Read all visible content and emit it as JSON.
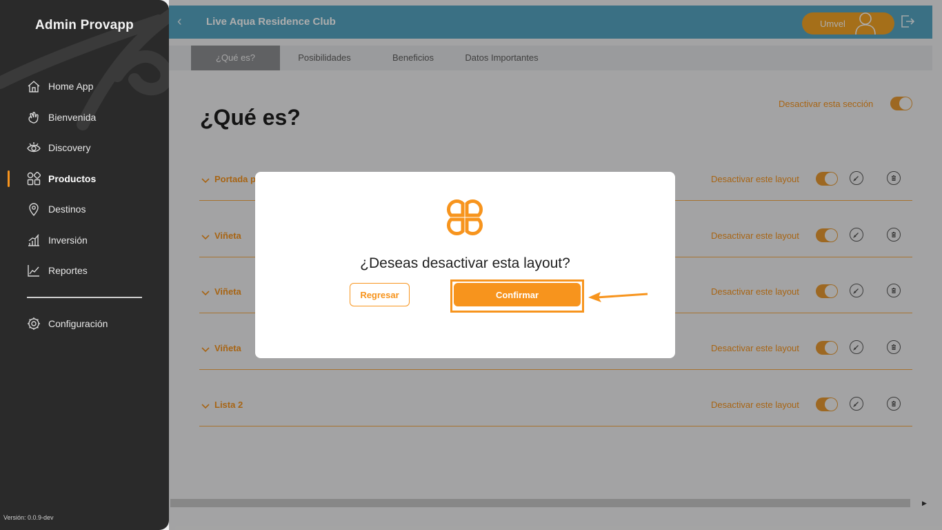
{
  "app": {
    "brand": "Admin Provapp",
    "version": "Versión: 0.0.9-dev"
  },
  "sidebar": {
    "items": [
      {
        "label": "Home App",
        "icon": "home-icon"
      },
      {
        "label": "Bienvenida",
        "icon": "waving-hand-icon"
      },
      {
        "label": "Discovery",
        "icon": "eye-icon"
      },
      {
        "label": "Productos",
        "icon": "grid-shapes-icon",
        "active": true
      },
      {
        "label": "Destinos",
        "icon": "map-pin-icon"
      },
      {
        "label": "Inversión",
        "icon": "bar-growth-icon"
      },
      {
        "label": "Reportes",
        "icon": "line-chart-icon"
      }
    ],
    "settings": {
      "label": "Configuración",
      "icon": "gear-icon"
    }
  },
  "header": {
    "title": "Live Aqua Residence Club",
    "user": "Umvel"
  },
  "tabs": [
    {
      "label": "¿Qué es?",
      "active": true
    },
    {
      "label": "Posibilidades"
    },
    {
      "label": "Beneficios"
    },
    {
      "label": "Datos Importantes"
    }
  ],
  "main": {
    "title": "¿Qué es?",
    "section_toggle_label": "Desactivar esta sección",
    "rows": [
      {
        "label": "Portada p",
        "deactivate": "Desactivar este layout"
      },
      {
        "label": "Viñeta",
        "deactivate": "Desactivar este layout"
      },
      {
        "label": "Viñeta",
        "deactivate": "Desactivar este layout"
      },
      {
        "label": "Viñeta",
        "deactivate": "Desactivar este layout"
      },
      {
        "label": "Lista 2",
        "deactivate": "Desactivar este layout"
      }
    ]
  },
  "modal": {
    "question": "¿Deseas desactivar esta layout?",
    "back_label": "Regresar",
    "confirm_label": "Confirmar"
  },
  "colors": {
    "accent": "#f7941d",
    "header": "#56a6c3",
    "sidebar": "#2a2a2a"
  }
}
